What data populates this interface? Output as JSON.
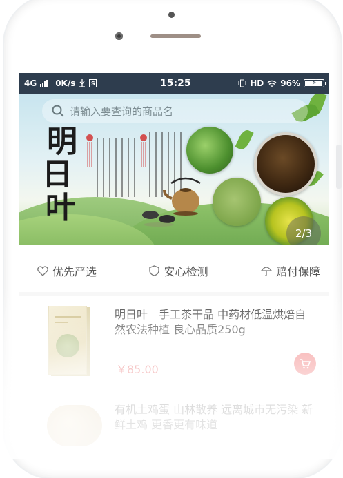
{
  "status_bar": {
    "network": "4G",
    "speed": "0K/s",
    "time": "15:25",
    "hd": "HD",
    "battery": "96%",
    "battery_level": 0.96
  },
  "banner": {
    "search_placeholder": "请输入要查询的商品名",
    "title_chars": [
      "明",
      "日",
      "叶"
    ],
    "pager": "2/3",
    "current_slide": 2,
    "total_slides": 3
  },
  "features": [
    {
      "icon": "heart-icon",
      "label": "优先严选"
    },
    {
      "icon": "shield-icon",
      "label": "安心检测"
    },
    {
      "icon": "umbrella-icon",
      "label": "赔付保障"
    }
  ],
  "products": [
    {
      "name": "明日叶　手工茶干品 中药材低温烘焙自然农法种植 良心品质250g",
      "price": "￥85.00"
    },
    {
      "name": "有机土鸡蛋 山林散养 远离城市无污染 新鲜土鸡 更香更有味道"
    }
  ],
  "colors": {
    "status_bar": "#2e3d4e",
    "price": "#e65c5c",
    "cart": "#f06a6a"
  }
}
